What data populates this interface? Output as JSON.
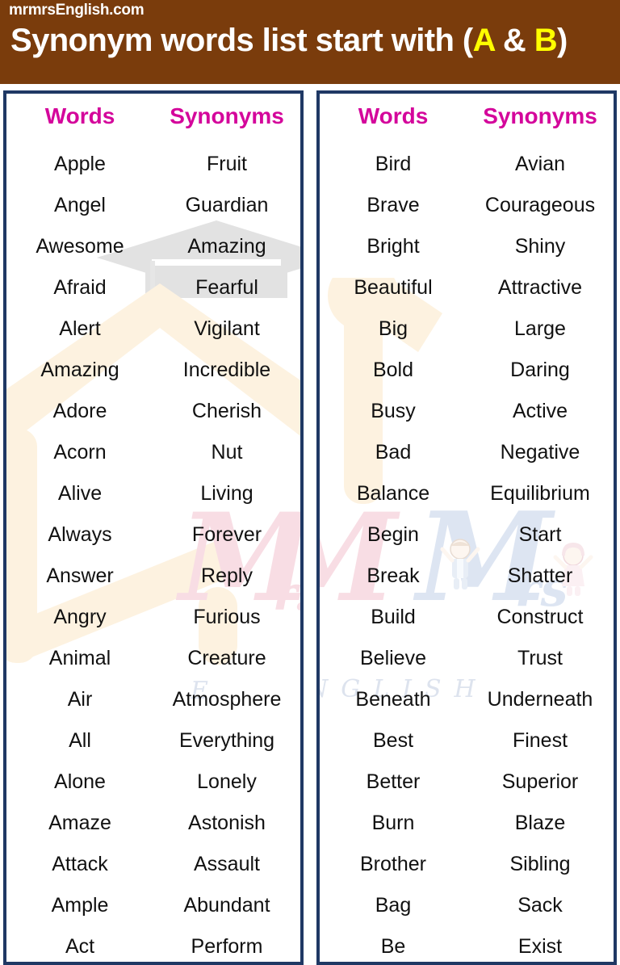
{
  "header": {
    "site_name": "mrmrsEnglish.com",
    "title_prefix": "Synonym words list start with (",
    "title_letter_a": "A",
    "title_amp": " & ",
    "title_letter_b": "B",
    "title_suffix": ")",
    "full_title": "Synonym words list start with (A & B)",
    "background_color": "#7a3c0c",
    "text_color": "#ffffff",
    "highlight_color": "#ffff00"
  },
  "panel_style": {
    "border_color": "#1f3864",
    "header_text_color": "#d4069b",
    "body_text_color": "#111111"
  },
  "watermark": {
    "brand_mr": "Mr.",
    "brand_mrs": "Mrs",
    "brand_english": "ENGLISH",
    "mr_color": "#f7dde4",
    "mrs_color": "#dde5f2",
    "cap_color": "#e0e0e0",
    "house_color": "#fdf3e2"
  },
  "panels": [
    {
      "id": "left",
      "columns": [
        "Words",
        "Synonyms"
      ],
      "rows": [
        [
          "Apple",
          "Fruit"
        ],
        [
          "Angel",
          "Guardian"
        ],
        [
          "Awesome",
          "Amazing"
        ],
        [
          "Afraid",
          "Fearful"
        ],
        [
          "Alert",
          "Vigilant"
        ],
        [
          "Amazing",
          "Incredible"
        ],
        [
          "Adore",
          "Cherish"
        ],
        [
          "Acorn",
          "Nut"
        ],
        [
          "Alive",
          "Living"
        ],
        [
          "Always",
          "Forever"
        ],
        [
          "Answer",
          "Reply"
        ],
        [
          "Angry",
          "Furious"
        ],
        [
          "Animal",
          "Creature"
        ],
        [
          "Air",
          "Atmosphere"
        ],
        [
          "All",
          "Everything"
        ],
        [
          "Alone",
          "Lonely"
        ],
        [
          "Amaze",
          "Astonish"
        ],
        [
          "Attack",
          "Assault"
        ],
        [
          "Ample",
          "Abundant"
        ],
        [
          "Act",
          "Perform"
        ]
      ]
    },
    {
      "id": "right",
      "columns": [
        "Words",
        "Synonyms"
      ],
      "rows": [
        [
          "Bird",
          "Avian"
        ],
        [
          "Brave",
          "Courageous"
        ],
        [
          "Bright",
          "Shiny"
        ],
        [
          "Beautiful",
          "Attractive"
        ],
        [
          "Big",
          "Large"
        ],
        [
          "Bold",
          "Daring"
        ],
        [
          "Busy",
          "Active"
        ],
        [
          "Bad",
          "Negative"
        ],
        [
          "Balance",
          "Equilibrium"
        ],
        [
          "Begin",
          "Start"
        ],
        [
          "Break",
          "Shatter"
        ],
        [
          "Build",
          "Construct"
        ],
        [
          "Believe",
          "Trust"
        ],
        [
          "Beneath",
          "Underneath"
        ],
        [
          "Best",
          "Finest"
        ],
        [
          "Better",
          "Superior"
        ],
        [
          "Burn",
          "Blaze"
        ],
        [
          "Brother",
          "Sibling"
        ],
        [
          "Bag",
          "Sack"
        ],
        [
          "Be",
          "Exist"
        ]
      ]
    }
  ]
}
